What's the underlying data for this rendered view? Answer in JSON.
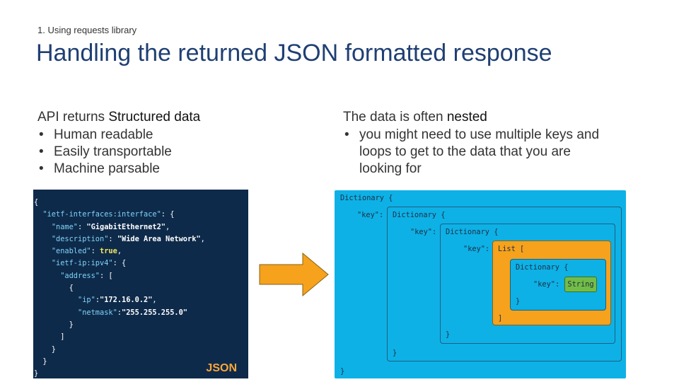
{
  "header": {
    "breadcrumb": "1. Using requests library",
    "title": "Handling the returned JSON formatted response"
  },
  "left_column": {
    "heading_prefix": "API returns ",
    "heading_emphasis": "Structured data",
    "bullets": [
      "Human readable",
      "Easily transportable",
      "Machine parsable"
    ]
  },
  "right_column": {
    "heading_prefix": "The data is often ",
    "heading_emphasis": "nested",
    "bullets": [
      "you might need to use multiple keys and loops to get to the data that you are looking for"
    ]
  },
  "json_panel": {
    "label": "JSON",
    "brace_open": "{",
    "brace_close": "}",
    "interface_key": "\"ietf-interfaces:interface\"",
    "name_key": "\"name\"",
    "name_value": "\"GigabitEthernet2\"",
    "description_key": "\"description\"",
    "description_value": "\"Wide Area Network\"",
    "enabled_key": "\"enabled\"",
    "enabled_value": "true",
    "ipv4_key": "\"ietf-ip:ipv4\"",
    "address_key": "\"address\"",
    "ip_key": "\"ip\"",
    "ip_value": "\"172.16.0.2\"",
    "netmask_key": "\"netmask\"",
    "netmask_value": "\"255.255.255.0\""
  },
  "nesting_diagram": {
    "dict_open": "Dictionary {",
    "dict_close": "}",
    "list_open": "List [",
    "list_close": "]",
    "key_label": "\"key\":",
    "string_label": "String"
  },
  "colors": {
    "title": "#1f3f73",
    "json_background": "#0e2a4a",
    "json_key": "#7fd3f7",
    "json_boolean": "#f1e760",
    "accent_orange": "#f6a21d",
    "diagram_background": "#0db1e6",
    "string_green": "#72bd47"
  }
}
